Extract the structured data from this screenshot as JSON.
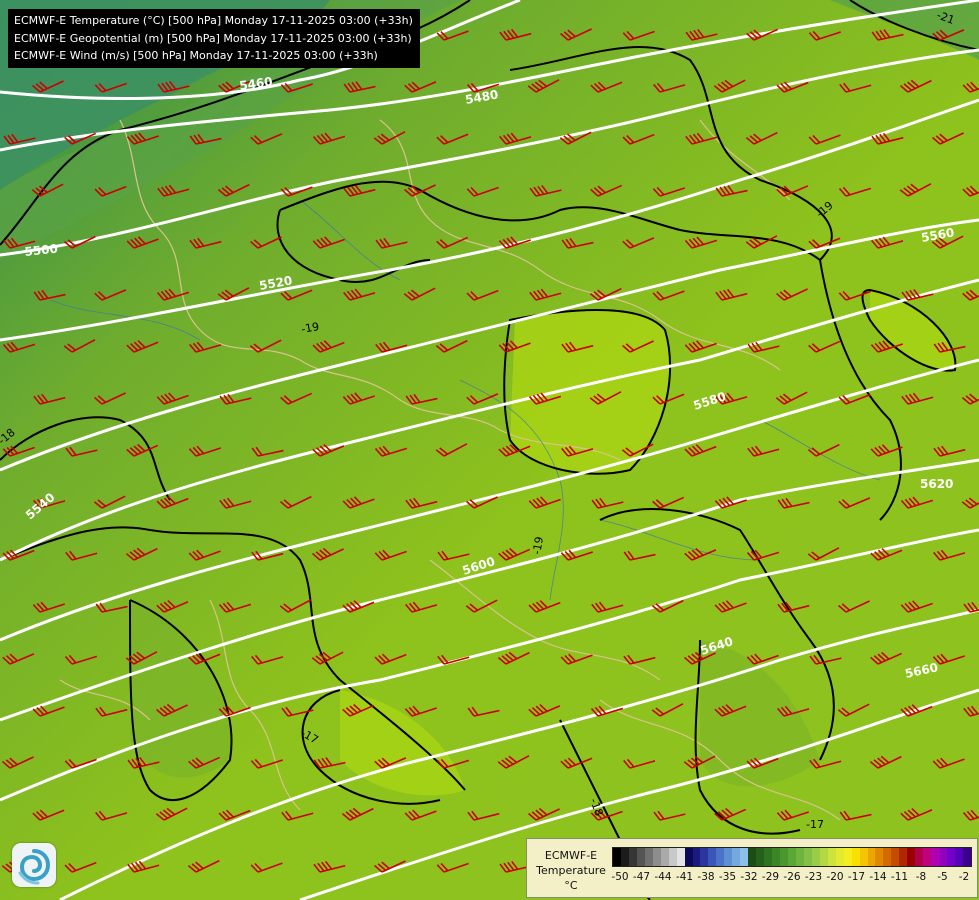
{
  "header": {
    "lines": [
      "ECMWF-E Temperature (°C) [500 hPa] Monday 17-11-2025 03:00 (+33h)",
      "ECMWF-E Geopotential (m) [500 hPa] Monday 17-11-2025 03:00 (+33h)",
      "ECMWF-E Wind (m/s) [500 hPa] Monday 17-11-2025 03:00 (+33h)"
    ]
  },
  "legend": {
    "line1": "ECMWF-E",
    "line2": "Temperature",
    "unit": "°C",
    "ticks": [
      "-50",
      "-47",
      "-44",
      "-41",
      "-38",
      "-35",
      "-32",
      "-29",
      "-26",
      "-23",
      "-20",
      "-17",
      "-14",
      "-11",
      "-8",
      "-5",
      "-2"
    ],
    "colors": [
      "#000000",
      "#1b1b1b",
      "#363636",
      "#545454",
      "#707070",
      "#8d8d8d",
      "#aaaaaa",
      "#c8c8c8",
      "#e4e4e4",
      "#0a0a5a",
      "#1a1a80",
      "#2a35a0",
      "#3a55b8",
      "#4a73c8",
      "#5c8fd4",
      "#74a8df",
      "#8cc0e8",
      "#1b4d14",
      "#24601a",
      "#2e7420",
      "#3a8626",
      "#4a972e",
      "#5aa636",
      "#6eb43e",
      "#84c046",
      "#9bcc48",
      "#b4d844",
      "#cde23c",
      "#e4ea30",
      "#f4ee20",
      "#f8e000",
      "#f4c400",
      "#eca600",
      "#e08800",
      "#d26a00",
      "#c44c00",
      "#b02800",
      "#980000",
      "#b0004a",
      "#c0007c",
      "#b000b0",
      "#9400c0",
      "#7400c8",
      "#5500b8",
      "#3c0090"
    ]
  },
  "map": {
    "layers": [
      "temperature",
      "geopotential",
      "wind"
    ],
    "geopotential_labels": [
      "5460",
      "5480",
      "5500",
      "5520",
      "5540",
      "5560",
      "5580",
      "5600",
      "5620",
      "5640",
      "5660"
    ],
    "temperature_labels": [
      "-21",
      "-19",
      "-19",
      "-19",
      "-18",
      "-18",
      "-17",
      "-17"
    ],
    "colors": {
      "field_base": "#86bc22",
      "warm_patch": "#a6d410",
      "cold_patch": "#4e9a52",
      "isotherm": "#000000",
      "isohypse": "#ffffff",
      "wind_barb": "#cc0000",
      "borders": "#d8c48c",
      "rivers": "#3e78a8"
    }
  },
  "logo_icon": "ecmwf-spiral-icon"
}
